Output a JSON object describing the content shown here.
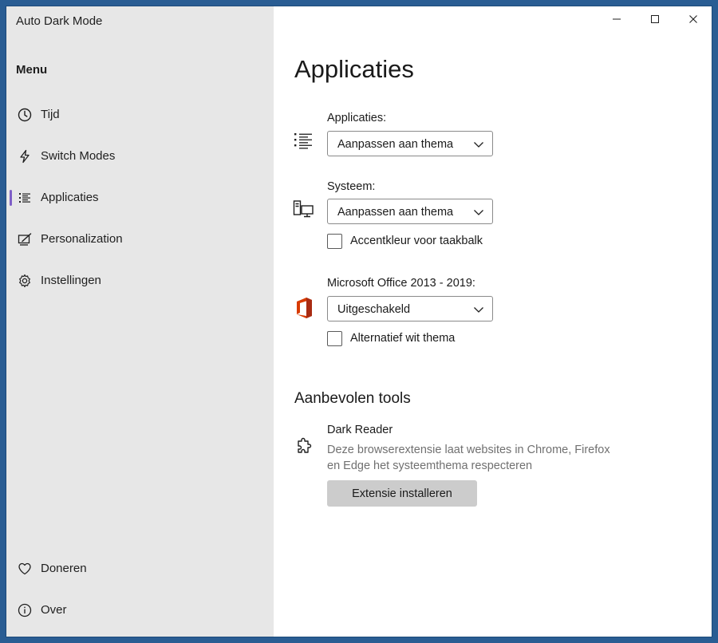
{
  "window": {
    "title": "Auto Dark Mode",
    "controls": [
      "minimize-icon",
      "maximize-icon",
      "close-icon"
    ]
  },
  "sidebar": {
    "menu_label": "Menu",
    "items": [
      {
        "label": "Tijd",
        "icon": "clock-icon"
      },
      {
        "label": "Switch Modes",
        "icon": "lightning-icon"
      },
      {
        "label": "Applicaties",
        "icon": "list-icon",
        "active": true
      },
      {
        "label": "Personalization",
        "icon": "personalize-icon"
      },
      {
        "label": "Instellingen",
        "icon": "gear-icon"
      }
    ],
    "footer_items": [
      {
        "label": "Doneren",
        "icon": "heart-icon"
      },
      {
        "label": "Over",
        "icon": "info-icon"
      }
    ]
  },
  "main": {
    "title": "Applicaties",
    "apps": {
      "label": "Applicaties:",
      "value": "Aanpassen aan thema"
    },
    "system": {
      "label": "Systeem:",
      "value": "Aanpassen aan thema",
      "checkbox_label": "Accentkleur voor taakbalk",
      "checked": false
    },
    "office": {
      "label": "Microsoft Office 2013 - 2019:",
      "value": "Uitgeschakeld",
      "checkbox_label": "Alternatief wit thema",
      "checked": false
    },
    "recommended": {
      "title": "Aanbevolen tools",
      "tool_name": "Dark Reader",
      "tool_desc": "Deze browserextensie laat websites in Chrome, Firefox en Edge het systeemthema respecteren",
      "button_label": "Extensie installeren"
    }
  },
  "colors": {
    "accent": "#7f5fc7",
    "sidebar_bg": "#e7e7e7",
    "office_red": "#d83b01",
    "desktop_bg": "#2a5d93"
  }
}
